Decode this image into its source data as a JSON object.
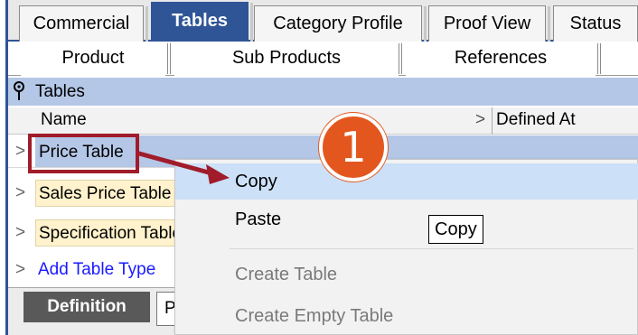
{
  "top_tabs": [
    {
      "label": "Commercial",
      "active": false
    },
    {
      "label": "Tables",
      "active": true
    },
    {
      "label": "Category Profile",
      "active": false
    },
    {
      "label": "Proof View",
      "active": false
    },
    {
      "label": "Status",
      "active": false
    }
  ],
  "sub_tabs": [
    {
      "label": "Product"
    },
    {
      "label": "Sub Products"
    },
    {
      "label": "References"
    }
  ],
  "section": {
    "title": "Tables",
    "icon": "pin-icon"
  },
  "grid": {
    "columns": {
      "name": "Name",
      "defined_at": "Defined At"
    },
    "rows": [
      {
        "name": "Price Table",
        "selected": true
      },
      {
        "name": "Sales Price Table",
        "selected": false
      },
      {
        "name": "Specification Table",
        "selected": false
      },
      {
        "name": "Add Table Type",
        "selected": false,
        "is_link": true
      }
    ]
  },
  "bottom_tabs": [
    {
      "label": "Definition",
      "active": true
    },
    {
      "label": "P",
      "active": false
    }
  ],
  "context_menu": {
    "items": [
      {
        "label": "Copy",
        "state": "hover"
      },
      {
        "label": "Paste",
        "state": "enabled"
      },
      {
        "label": "Create Table",
        "state": "disabled"
      },
      {
        "label": "Create Empty Table",
        "state": "disabled"
      }
    ]
  },
  "tooltip": {
    "text": "Copy"
  },
  "callout": {
    "step": "1"
  },
  "colors": {
    "accent": "#2f5597",
    "header_band": "#b4c7e7",
    "row_fill": "#fff2cc",
    "highlight_border": "#a01c2a",
    "badge": "#e3571f",
    "menu_hover": "#cce0f7"
  }
}
